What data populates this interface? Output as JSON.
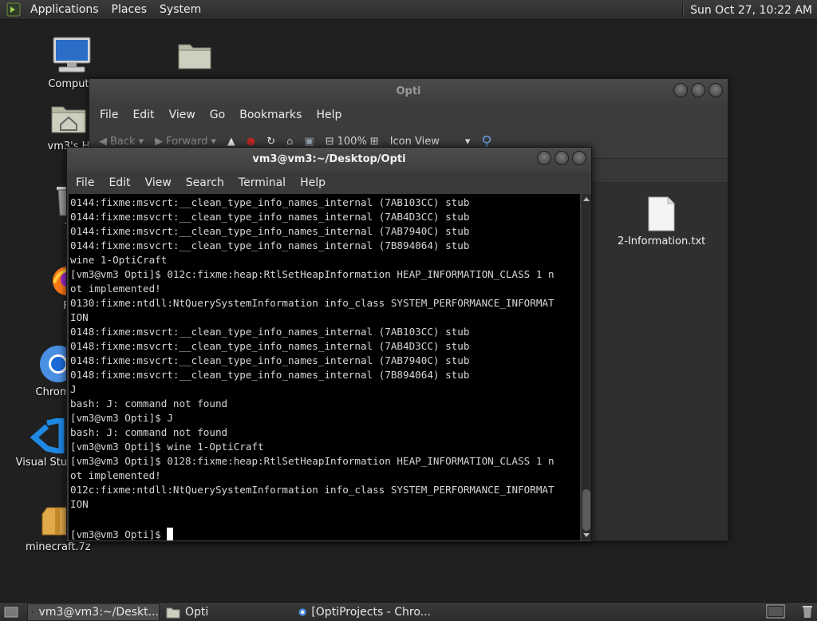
{
  "top_panel": {
    "menus": [
      "Applications",
      "Places",
      "System"
    ],
    "clock": "Sun Oct 27, 10:22 AM"
  },
  "desktop": {
    "icons": [
      {
        "label": "Compute",
        "icon": "computer-icon"
      },
      {
        "label": "",
        "icon": "folder-icon"
      },
      {
        "label": "vm3's H",
        "icon": "home-folder-icon"
      },
      {
        "label": "Tr",
        "icon": "trash-icon"
      },
      {
        "label": "Fir",
        "icon": "firefox-icon"
      },
      {
        "label": "Chrom",
        "icon": "chrome-icon"
      },
      {
        "label": "Visual Stud",
        "icon": "vscode-icon"
      },
      {
        "label": "minecraft.7z",
        "icon": "archive-icon"
      }
    ]
  },
  "file_manager": {
    "title": "Opti",
    "menu": [
      "File",
      "Edit",
      "View",
      "Go",
      "Bookmarks",
      "Help"
    ],
    "toolbar": {
      "back": "Back",
      "forward": "Forward",
      "zoom": "100%",
      "view_mode": "Icon View"
    },
    "files": [
      {
        "name": "2-Information.txt",
        "icon": "text-file-icon"
      }
    ]
  },
  "terminal": {
    "title": "vm3@vm3:~/Desktop/Opti",
    "menu": [
      "File",
      "Edit",
      "View",
      "Search",
      "Terminal",
      "Help"
    ],
    "lines": [
      "0144:fixme:msvcrt:__clean_type_info_names_internal (7AB103CC) stub",
      "0144:fixme:msvcrt:__clean_type_info_names_internal (7AB4D3CC) stub",
      "0144:fixme:msvcrt:__clean_type_info_names_internal (7AB7940C) stub",
      "0144:fixme:msvcrt:__clean_type_info_names_internal (7B894064) stub",
      "wine 1-OptiCraft",
      "[vm3@vm3 Opti]$ 012c:fixme:heap:RtlSetHeapInformation HEAP_INFORMATION_CLASS 1 n",
      "ot implemented!",
      "0130:fixme:ntdll:NtQuerySystemInformation info_class SYSTEM_PERFORMANCE_INFORMAT",
      "ION",
      "0148:fixme:msvcrt:__clean_type_info_names_internal (7AB103CC) stub",
      "0148:fixme:msvcrt:__clean_type_info_names_internal (7AB4D3CC) stub",
      "0148:fixme:msvcrt:__clean_type_info_names_internal (7AB7940C) stub",
      "0148:fixme:msvcrt:__clean_type_info_names_internal (7B894064) stub",
      "J",
      "bash: J: command not found",
      "[vm3@vm3 Opti]$ J",
      "bash: J: command not found",
      "[vm3@vm3 Opti]$ wine 1-OptiCraft",
      "[vm3@vm3 Opti]$ 0128:fixme:heap:RtlSetHeapInformation HEAP_INFORMATION_CLASS 1 n",
      "ot implemented!",
      "012c:fixme:ntdll:NtQuerySystemInformation info_class SYSTEM_PERFORMANCE_INFORMAT",
      "ION",
      ""
    ],
    "prompt": "[vm3@vm3 Opti]$ "
  },
  "taskbar": {
    "tasks": [
      {
        "label": "vm3@vm3:~/Deskt...",
        "icon": "terminal-icon",
        "active": true
      },
      {
        "label": "Opti",
        "icon": "folder-icon",
        "active": false
      },
      {
        "label": "[OptiProjects - Chro...",
        "icon": "chrome-icon",
        "active": false
      }
    ]
  }
}
